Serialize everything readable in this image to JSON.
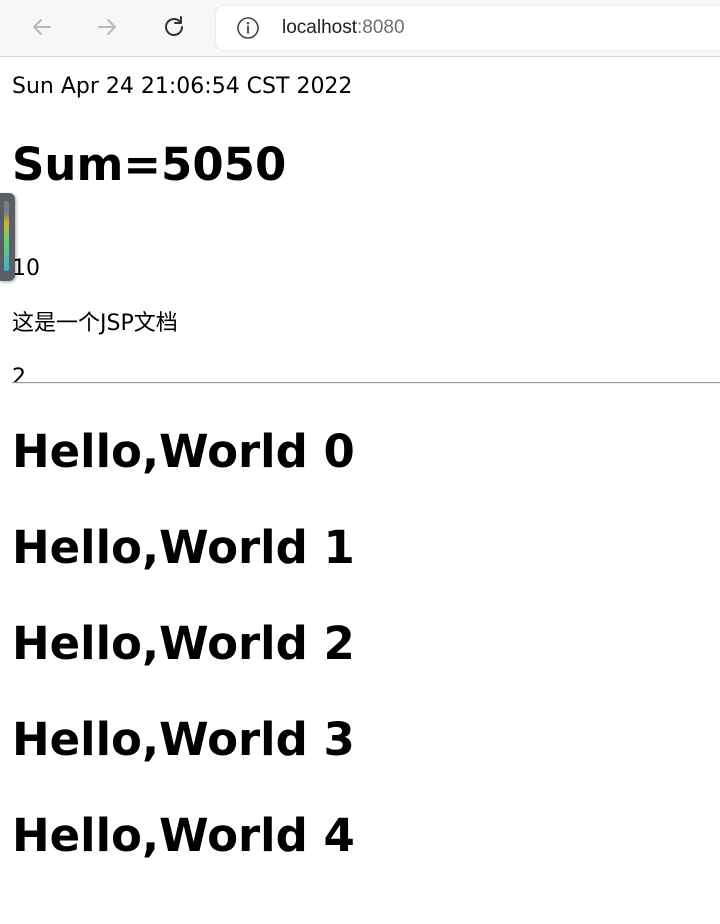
{
  "browser": {
    "back_icon": "arrow-left-icon",
    "forward_icon": "arrow-right-icon",
    "reload_icon": "reload-icon",
    "info_icon": "info-circle-icon",
    "url_host": "localhost",
    "url_port": ":8080"
  },
  "page": {
    "date": "Sun Apr 24 21:06:54 CST 2022",
    "sum_heading": "Sum=5050",
    "lines": [
      "10",
      "这是一个JSP文档",
      "2"
    ],
    "hello_items": [
      "Hello,World 0",
      "Hello,World 1",
      "Hello,World 2",
      "Hello,World 3",
      "Hello,World 4"
    ]
  },
  "side_widget_icon": "audio-meter-icon"
}
